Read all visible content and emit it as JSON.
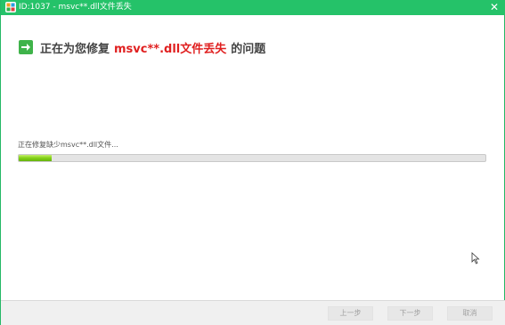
{
  "window": {
    "title": "ID:1037 - msvc**.dll文件丢失",
    "close_glyph": "✕"
  },
  "heading": {
    "prefix": "正在为您修复",
    "highlight": "msvc**.dll文件丢失",
    "suffix": "的问题"
  },
  "status": {
    "text": "正在修复缺少msvc**.dll文件..."
  },
  "progress": {
    "percent": 7
  },
  "footer": {
    "prev_label": "上一步",
    "next_label": "下一步",
    "cancel_label": "取消"
  },
  "colors": {
    "titlebar": "#25c269",
    "accent_red": "#e02020",
    "progress_green": "#87d41c"
  },
  "icons": [
    "app-logo-icon",
    "close-icon",
    "arrow-right-icon",
    "mouse-cursor-icon"
  ]
}
